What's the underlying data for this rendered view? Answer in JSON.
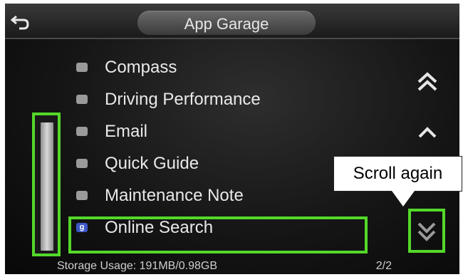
{
  "header": {
    "title": "App Garage",
    "back_icon": "back-arrow-icon"
  },
  "list": {
    "items": [
      {
        "label": "Compass",
        "icon": "compass-icon"
      },
      {
        "label": "Driving Performance",
        "icon": "driving-performance-icon"
      },
      {
        "label": "Email",
        "icon": "email-icon"
      },
      {
        "label": "Quick Guide",
        "icon": "quick-guide-icon"
      },
      {
        "label": "Maintenance Note",
        "icon": "maintenance-note-icon"
      },
      {
        "label": "Online Search",
        "icon": "online-search-icon",
        "icon_glyph": "g"
      }
    ]
  },
  "footer": {
    "storage": "Storage Usage: 191MB/0.98GB",
    "page": "2/2"
  },
  "callout": {
    "text": "Scroll again"
  },
  "scroll_buttons": [
    "page-up-icon",
    "line-up-icon",
    "page-down-icon"
  ],
  "colors": {
    "highlight": "#54d82a",
    "background": "#151515",
    "text": "#e9e9e9"
  }
}
